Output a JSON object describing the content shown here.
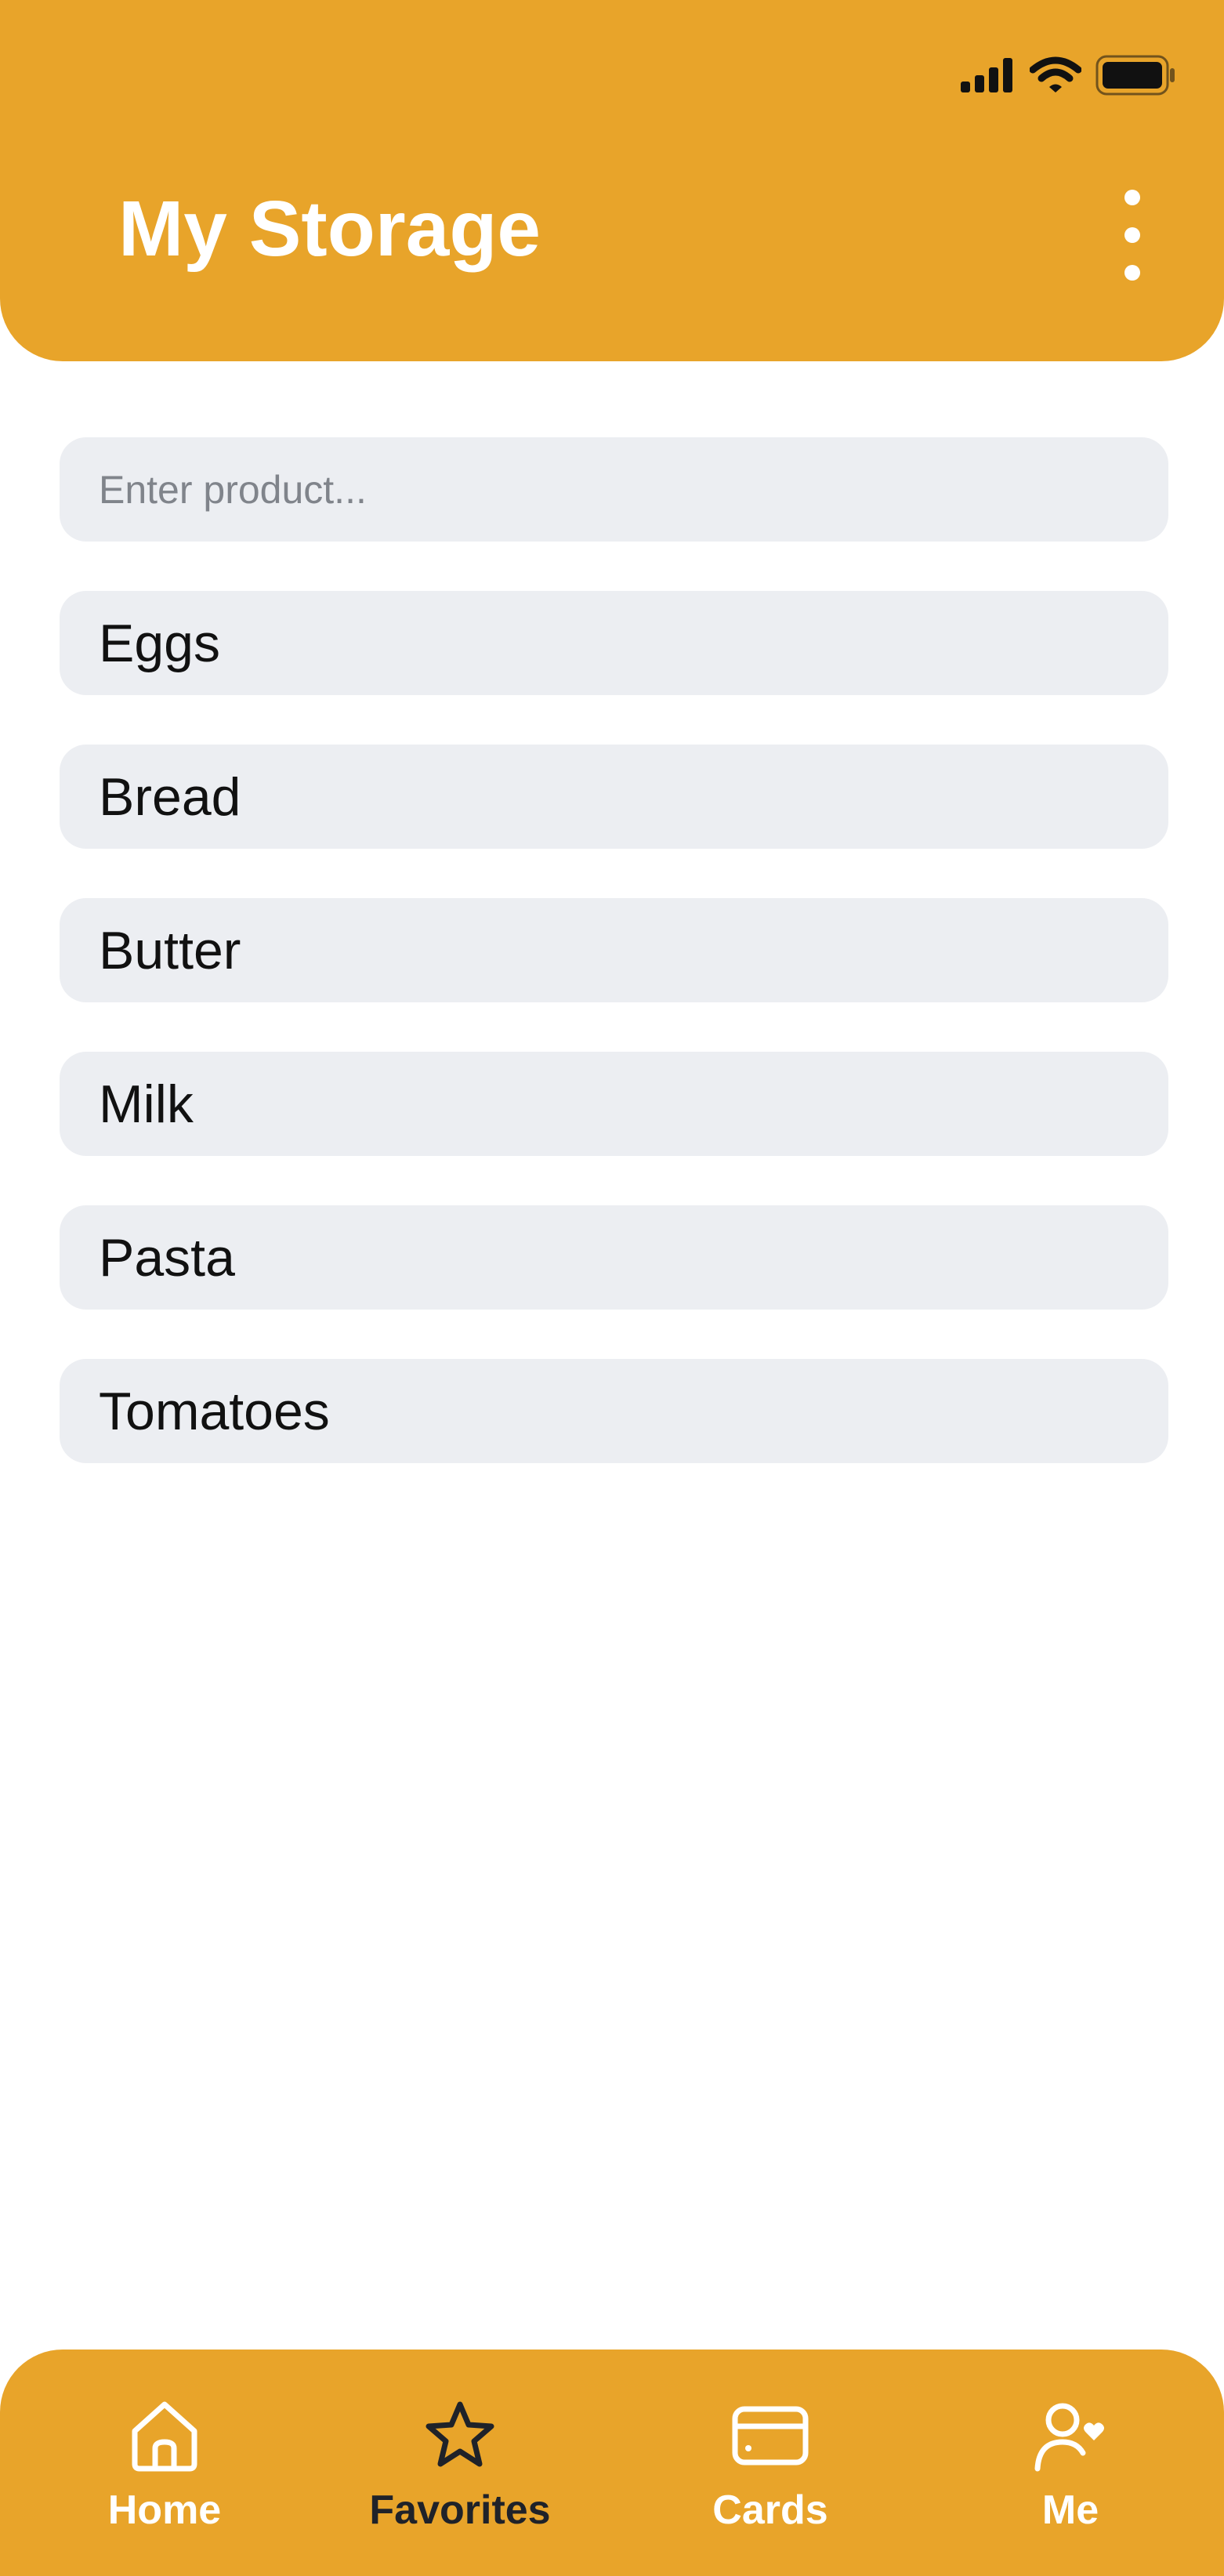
{
  "theme": {
    "accent": "#E8A42A",
    "field_bg": "#ECEEF2",
    "active_tab_color": "#1F2229"
  },
  "status_bar": {
    "icons": [
      "cellular-signal-icon",
      "wifi-icon",
      "battery-icon"
    ]
  },
  "header": {
    "title": "My Storage",
    "menu_icon": "more-vertical-icon"
  },
  "search": {
    "value": "",
    "placeholder": "Enter product..."
  },
  "products": [
    {
      "name": "Eggs"
    },
    {
      "name": "Bread"
    },
    {
      "name": "Butter"
    },
    {
      "name": "Milk"
    },
    {
      "name": "Pasta"
    },
    {
      "name": "Tomatoes"
    }
  ],
  "tab_bar": {
    "active": "favorites",
    "tabs": [
      {
        "id": "home",
        "label": "Home",
        "icon": "home-icon"
      },
      {
        "id": "favorites",
        "label": "Favorites",
        "icon": "star-icon"
      },
      {
        "id": "cards",
        "label": "Cards",
        "icon": "card-icon"
      },
      {
        "id": "me",
        "label": "Me",
        "icon": "user-heart-icon"
      }
    ]
  }
}
